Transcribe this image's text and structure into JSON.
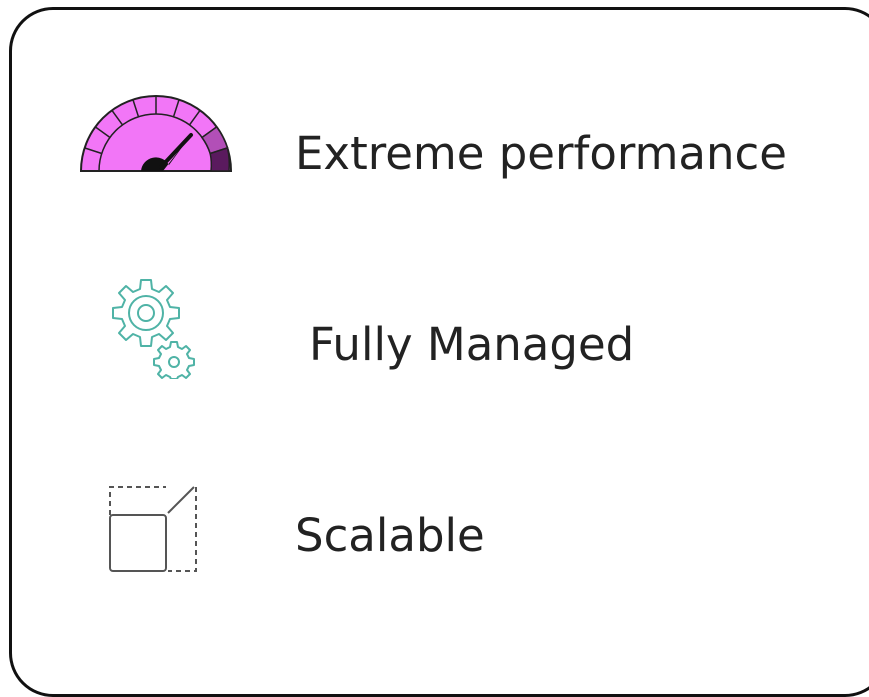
{
  "features": [
    {
      "label": "Extreme performance",
      "icon": "speedometer-icon",
      "color": "#f276f7"
    },
    {
      "label": "Fully Managed",
      "icon": "gears-icon",
      "color": "#4fb3a6"
    },
    {
      "label": "Scalable",
      "icon": "resize-icon",
      "color": "#555555"
    }
  ]
}
